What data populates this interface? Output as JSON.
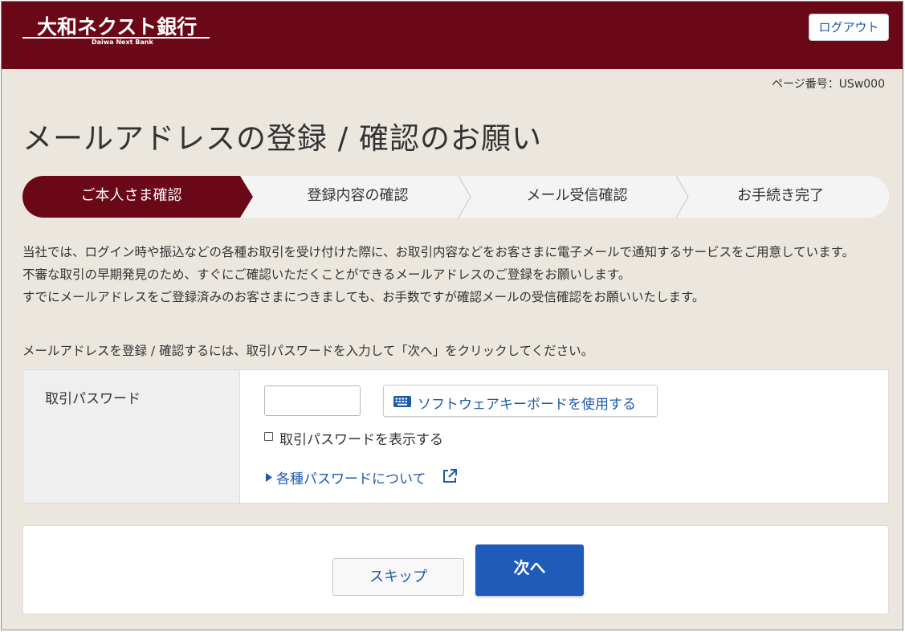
{
  "header": {
    "logo_text": "大和ネクスト銀行",
    "logo_sub": "Daiwa Next Bank",
    "logout_label": "ログアウト"
  },
  "page_number": "ページ番号：USw000",
  "title": "メールアドレスの登録 / 確認のお願い",
  "steps": [
    {
      "label": "ご本人さま確認",
      "active": true
    },
    {
      "label": "登録内容の確認",
      "active": false
    },
    {
      "label": "メール受信確認",
      "active": false
    },
    {
      "label": "お手続き完了",
      "active": false
    }
  ],
  "intro": {
    "line1": "当社では、ログイン時や振込などの各種お取引を受け付けた際に、お取引内容などをお客さまに電子メールで通知するサービスをご用意しています。",
    "line2": "不審な取引の早期発見のため、すぐにご確認いただくことができるメールアドレスのご登録をお願いします。",
    "line3": "すでにメールアドレスをご登録済みのお客さまにつきましても、お手数ですが確認メールの受信確認をお願いいたします。"
  },
  "instruction": "メールアドレスを登録 / 確認するには、取引パスワードを入力して「次へ」をクリックしてください。",
  "form": {
    "password_label": "取引パスワード",
    "password_value": "",
    "software_keyboard_label": "ソフトウェアキーボードを使用する",
    "show_password_label": "取引パスワードを表示する",
    "password_info_link": "各種パスワードについて"
  },
  "actions": {
    "skip_label": "スキップ",
    "next_label": "次へ"
  },
  "colors": {
    "brand": "#6b0818",
    "link": "#1d5aa8",
    "primary_button": "#1f5bb9",
    "background": "#ebe7df"
  },
  "icons": {
    "keyboard": "keyboard-icon",
    "external": "external-link-icon",
    "arrow": "triangle-right-icon"
  }
}
